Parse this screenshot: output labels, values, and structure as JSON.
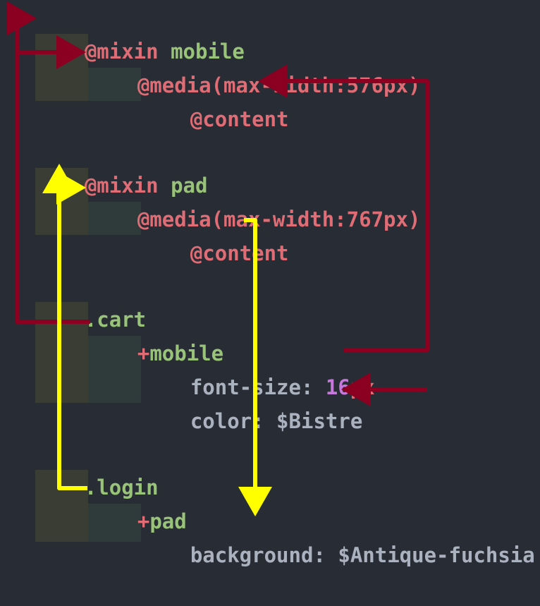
{
  "colors": {
    "background": "#282c34",
    "keyword": "#e06c75",
    "name": "#98c379",
    "property": "#abb2bf",
    "number": "#c678dd",
    "arrow_mobile": "#8b0020",
    "arrow_pad": "#ffff00"
  },
  "code": {
    "line1": {
      "kw": "@mixin",
      "name": " mobile"
    },
    "line2": {
      "text": "@media(max-width:576px)"
    },
    "line3": {
      "text": "@content"
    },
    "line5": {
      "kw": "@mixin",
      "name": " pad"
    },
    "line6": {
      "text": "@media(max-width:767px)"
    },
    "line7": {
      "text": "@content"
    },
    "line9": {
      "text": ".cart"
    },
    "line10": {
      "plus": "+",
      "name": "mobile"
    },
    "line11": {
      "prop": "font-size: ",
      "num": "16",
      "unit": "px"
    },
    "line12": {
      "text": "color: $Bistre"
    },
    "line14": {
      "text": ".login"
    },
    "line15": {
      "plus": "+",
      "name": "pad"
    },
    "line16": {
      "text": "background: $Antique-fuchsia"
    }
  }
}
